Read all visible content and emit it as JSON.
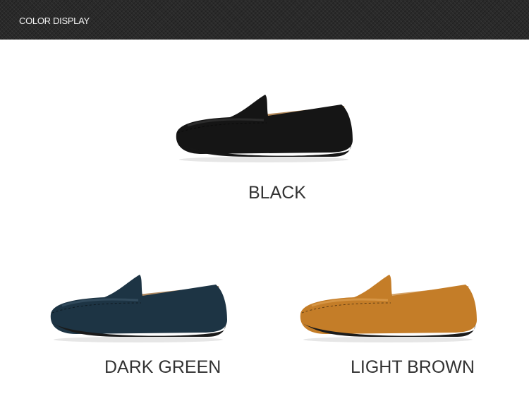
{
  "header": {
    "title": "COLOR DISPLAY"
  },
  "products": [
    {
      "label": "BLACK",
      "upper": "#151515",
      "upper_light": "#3a3a3a",
      "lining": "#b48a5a",
      "sole": "#161616"
    },
    {
      "label": "DARK GREEN",
      "upper": "#1d3444",
      "upper_light": "#3f5a6c",
      "lining": "#b08a62",
      "sole": "#1a1a1a"
    },
    {
      "label": "LIGHT BROWN",
      "upper": "#c47d28",
      "upper_light": "#e2a556",
      "lining": "#d6a56a",
      "sole": "#1b1b1b"
    }
  ]
}
